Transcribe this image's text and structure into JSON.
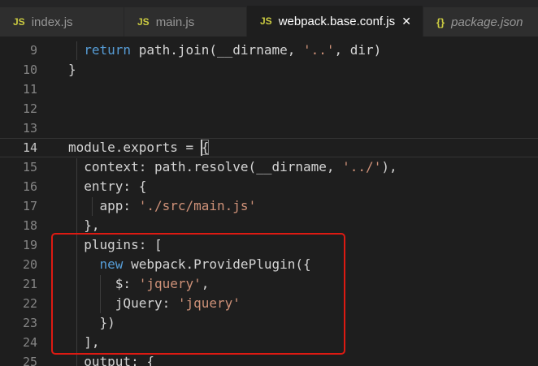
{
  "colors": {
    "editor_bg": "#1e1e1e",
    "tabbar_bg": "#252526",
    "inactive_tab_bg": "#2e2e2e",
    "keyword": "#569cd6",
    "string": "#ce9178",
    "text": "#d4d4d4",
    "line_number": "#858585",
    "icon_yellow": "#cbcb41",
    "annotation_red": "#dd1a12"
  },
  "icons": {
    "js": "JS",
    "braces": "{}",
    "close": "✕"
  },
  "tabs": [
    {
      "label": "index.js",
      "active": false
    },
    {
      "label": "main.js",
      "active": false
    },
    {
      "label": "webpack.base.conf.js",
      "active": true
    },
    {
      "label": "package.json",
      "active": false,
      "preview": true
    }
  ],
  "editor": {
    "lines": [
      {
        "num": "9",
        "tokens": [
          {
            "k": "txt",
            "t": "  "
          },
          {
            "k": "kw",
            "t": "return"
          },
          {
            "k": "txt",
            "t": " path.join(__dirname, "
          },
          {
            "k": "str",
            "t": "'..'"
          },
          {
            "k": "txt",
            "t": ", dir)"
          }
        ]
      },
      {
        "num": "10",
        "tokens": [
          {
            "k": "txt",
            "t": "}"
          }
        ]
      },
      {
        "num": "11",
        "tokens": []
      },
      {
        "num": "12",
        "tokens": []
      },
      {
        "num": "13",
        "tokens": []
      },
      {
        "num": "14",
        "current": true,
        "tokens": [
          {
            "k": "txt",
            "t": "module.exports = "
          },
          {
            "k": "brk",
            "t": "{"
          }
        ]
      },
      {
        "num": "15",
        "tokens": [
          {
            "k": "txt",
            "t": "  context: path.resolve(__dirname, "
          },
          {
            "k": "str",
            "t": "'../'"
          },
          {
            "k": "txt",
            "t": "),"
          }
        ]
      },
      {
        "num": "16",
        "tokens": [
          {
            "k": "txt",
            "t": "  entry: {"
          }
        ]
      },
      {
        "num": "17",
        "tokens": [
          {
            "k": "txt",
            "t": "    app: "
          },
          {
            "k": "str",
            "t": "'./src/main.js'"
          }
        ]
      },
      {
        "num": "18",
        "tokens": [
          {
            "k": "txt",
            "t": "  },"
          }
        ]
      },
      {
        "num": "19",
        "tokens": [
          {
            "k": "txt",
            "t": "  plugins: ["
          }
        ]
      },
      {
        "num": "20",
        "tokens": [
          {
            "k": "txt",
            "t": "    "
          },
          {
            "k": "kw",
            "t": "new"
          },
          {
            "k": "txt",
            "t": " webpack.ProvidePlugin({"
          }
        ]
      },
      {
        "num": "21",
        "tokens": [
          {
            "k": "txt",
            "t": "      $: "
          },
          {
            "k": "str",
            "t": "'jquery'"
          },
          {
            "k": "txt",
            "t": ","
          }
        ]
      },
      {
        "num": "22",
        "tokens": [
          {
            "k": "txt",
            "t": "      jQuery: "
          },
          {
            "k": "str",
            "t": "'jquery'"
          }
        ]
      },
      {
        "num": "23",
        "tokens": [
          {
            "k": "txt",
            "t": "    })"
          }
        ]
      },
      {
        "num": "24",
        "tokens": [
          {
            "k": "txt",
            "t": "  ],"
          }
        ]
      },
      {
        "num": "25",
        "tokens": [
          {
            "k": "txt",
            "t": "  output: {"
          }
        ]
      }
    ]
  }
}
